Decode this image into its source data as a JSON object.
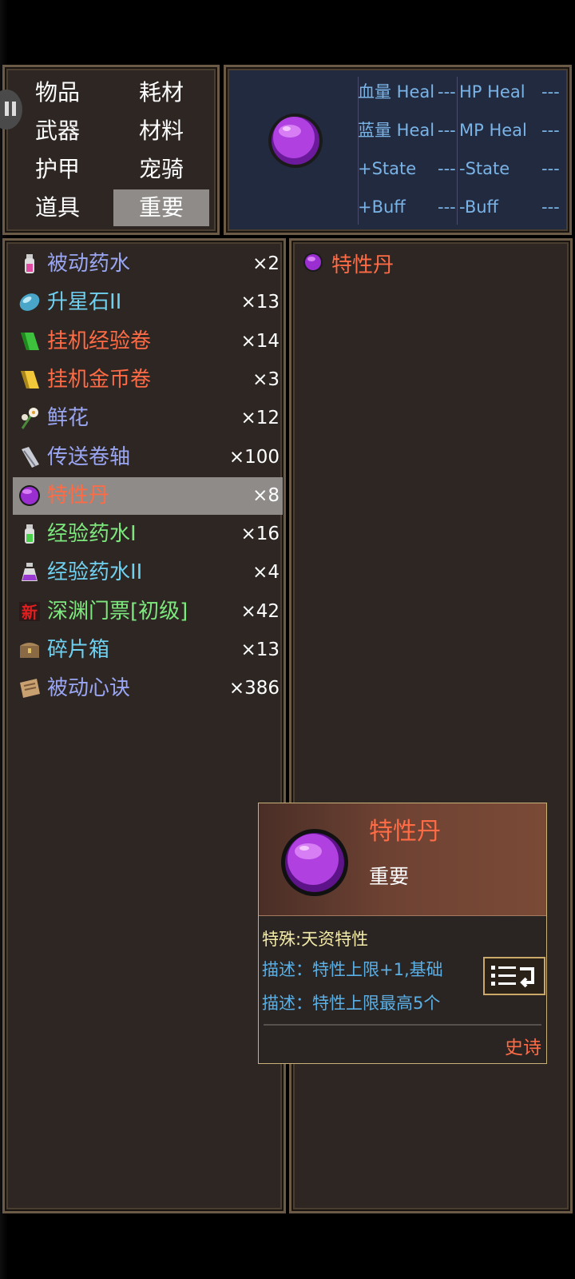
{
  "categories": [
    {
      "label": "物品"
    },
    {
      "label": "耗材"
    },
    {
      "label": "武器"
    },
    {
      "label": "材料"
    },
    {
      "label": "护甲"
    },
    {
      "label": "宠骑"
    },
    {
      "label": "道具"
    },
    {
      "label": "重要"
    }
  ],
  "stats": {
    "hp_heal_cn": "血量 Heal",
    "hp_heal_cn_val": "---",
    "hp_heal_en": "HP Heal",
    "hp_heal_en_val": "---",
    "mp_heal_cn": "蓝量 Heal",
    "mp_heal_cn_val": "---",
    "mp_heal_en": "MP Heal",
    "mp_heal_en_val": "---",
    "plus_state": "+State",
    "plus_state_val": "---",
    "minus_state": "-State",
    "minus_state_val": "---",
    "plus_buff": "+Buff",
    "plus_buff_val": "---",
    "minus_buff": "-Buff",
    "minus_buff_val": "---"
  },
  "items": [
    {
      "name": "被动药水",
      "count": "×2",
      "color": "#9aa6f2",
      "icon": "potion-pink-icon"
    },
    {
      "name": "升星石II",
      "count": "×13",
      "color": "#6fd0f0",
      "icon": "gem-stone-icon"
    },
    {
      "name": "挂机经验卷",
      "count": "×14",
      "color": "#ff6b45",
      "icon": "green-scroll-icon"
    },
    {
      "name": "挂机金币卷",
      "count": "×3",
      "color": "#ff6b45",
      "icon": "gold-scroll-icon"
    },
    {
      "name": "鲜花",
      "count": "×12",
      "color": "#9aa6f2",
      "icon": "flower-icon"
    },
    {
      "name": "传送卷轴",
      "count": "×100",
      "color": "#9aa6f2",
      "icon": "teleport-scroll-icon"
    },
    {
      "name": "特性丹",
      "count": "×8",
      "color": "#ff6b45",
      "icon": "purple-orb-icon"
    },
    {
      "name": "经验药水I",
      "count": "×16",
      "color": "#7de87d",
      "icon": "potion-green-icon"
    },
    {
      "name": "经验药水II",
      "count": "×4",
      "color": "#6fd0f0",
      "icon": "potion-purple-icon"
    },
    {
      "name": "深渊门票[初级]",
      "count": "×42",
      "color": "#7de87d",
      "icon": "new-ticket-icon"
    },
    {
      "name": "碎片箱",
      "count": "×13",
      "color": "#6fd0f0",
      "icon": "chest-icon"
    },
    {
      "name": "被动心诀",
      "count": "×386",
      "color": "#9aa6f2",
      "icon": "parchment-icon"
    }
  ],
  "detail": {
    "title": "特性丹"
  },
  "tooltip": {
    "title": "特性丹",
    "category": "重要",
    "special": "特殊:天资特性",
    "desc1": "描述：特性上限+1,基础",
    "desc2": "描述：特性上限最高5个",
    "rarity": "史诗"
  },
  "colors": {
    "orange": "#ff6b45",
    "blue": "#7ab4e6",
    "purple": "#b040e0"
  }
}
